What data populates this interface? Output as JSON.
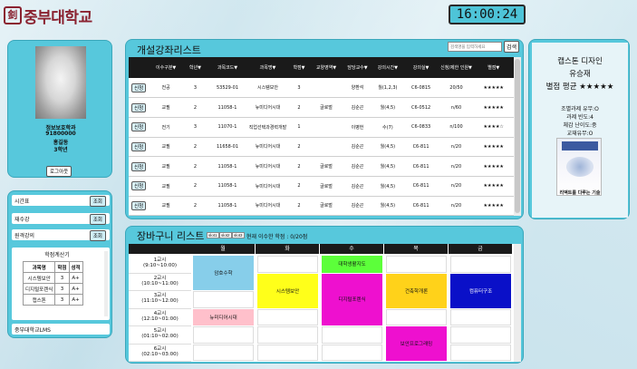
{
  "logo": {
    "mark": "釗",
    "title": "중부대학교"
  },
  "clock": "16:00:24",
  "profile": {
    "dept": "정보보호학과",
    "student_id": "91800000",
    "name": "홍길동",
    "year": "3학년",
    "logout_label": "로그아웃"
  },
  "menu": {
    "items": [
      {
        "label": "시간표",
        "button": "조회"
      },
      {
        "label": "재수강",
        "button": "조회"
      },
      {
        "label": "원격강의",
        "button": "조회"
      }
    ],
    "grade_title": "학점계산기",
    "grade_headers": [
      "과목명",
      "학점",
      "성적"
    ],
    "grade_rows": [
      [
        "시스템보안",
        "3",
        "A+"
      ],
      [
        "디지털포렌식",
        "3",
        "A+"
      ],
      [
        "캡스톤",
        "3",
        "A+"
      ]
    ],
    "lms": "중부대학교LMS"
  },
  "courses": {
    "title": "개설강좌리스트",
    "search_placeholder": "검색명을 입력하세요",
    "search_button": "검색",
    "headers": [
      "",
      "이수구분▼",
      "학년▼",
      "과목코드▼",
      "과목명▼",
      "학점▼",
      "교양영역▼",
      "담당교수▼",
      "강의시간▼",
      "강의실▼",
      "신청/제한 인원▼",
      "별점▼"
    ],
    "apply_label": "신청",
    "rows": [
      [
        "전공",
        "3",
        "53529-01",
        "시스템보안",
        "3",
        "",
        "양환석",
        "월(1,2,3)",
        "C6-0815",
        "20/50",
        "★★★★★"
      ],
      [
        "교필",
        "2",
        "11058-1",
        "뉴미디어시대",
        "2",
        "글로벌",
        "김순곤",
        "월(4,5)",
        "C6-0512",
        "n/60",
        "★★★★★"
      ],
      [
        "전기",
        "3",
        "11070-1",
        "직업선택과경력개발",
        "1",
        "",
        "이병헌",
        "수(7)",
        "C6-0833",
        "n/100",
        "★★★★☆"
      ],
      [
        "교필",
        "2",
        "11658-01",
        "뉴미디어시대",
        "2",
        "",
        "김순곤",
        "월(4,5)",
        "C6-811",
        "n/20",
        "★★★★★"
      ],
      [
        "교필",
        "2",
        "11058-1",
        "뉴미디어시대",
        "2",
        "글로벌",
        "김순곤",
        "월(4,5)",
        "C6-811",
        "n/20",
        "★★★★★"
      ],
      [
        "교필",
        "2",
        "11058-1",
        "뉴미디어시대",
        "2",
        "글로벌",
        "김순곤",
        "월(4,5)",
        "C6-811",
        "n/20",
        "★★★★★"
      ],
      [
        "교필",
        "2",
        "11058-1",
        "뉴미디어시대",
        "2",
        "글로벌",
        "김순곤",
        "월(4,5)",
        "C6-811",
        "n/20",
        "★★★★★"
      ]
    ]
  },
  "detail": {
    "title": "캡스톤 디자인",
    "professor": "유승재",
    "rating": "별점 평균 ★★★★★",
    "lines": [
      "조별과제 유무:O",
      "과제 빈도:4",
      "체감 난이도:중",
      "교재유무:O"
    ],
    "book_caption": "리액트를 다루는 기술"
  },
  "cart": {
    "title": "장바구니 리스트",
    "slots": [
      "slot1",
      "slot2",
      "slot3"
    ],
    "info": "현재 이수한 학점 :   0/20점",
    "days": [
      "월",
      "화",
      "수",
      "목",
      "금"
    ],
    "periods": [
      [
        "1교시",
        "(9:10~10:00)"
      ],
      [
        "2교시",
        "(10:10~11:00)"
      ],
      [
        "3교시",
        "(11:10~12:00)"
      ],
      [
        "4교시",
        "(12:10~01:00)"
      ],
      [
        "5교시",
        "(01:10~02:00)"
      ],
      [
        "6교시",
        "(02:10~03:00)"
      ]
    ],
    "blocks": [
      {
        "label": "암호수학",
        "color": "#87ceea"
      },
      {
        "label": "시스템보안",
        "color": "#ffff1a"
      },
      {
        "label": "대학생활지도",
        "color": "#5cff3a"
      },
      {
        "label": "디지털포렌식",
        "color": "#ee10cf"
      },
      {
        "label": "건축학개론",
        "color": "#ffd21a"
      },
      {
        "label": "컴퓨터구조",
        "color": "#0a10c8"
      },
      {
        "label": "뉴미디어시대",
        "color": "#ffc0cb"
      },
      {
        "label": "보안프로그래밍",
        "color": "#ee10cf"
      }
    ]
  }
}
